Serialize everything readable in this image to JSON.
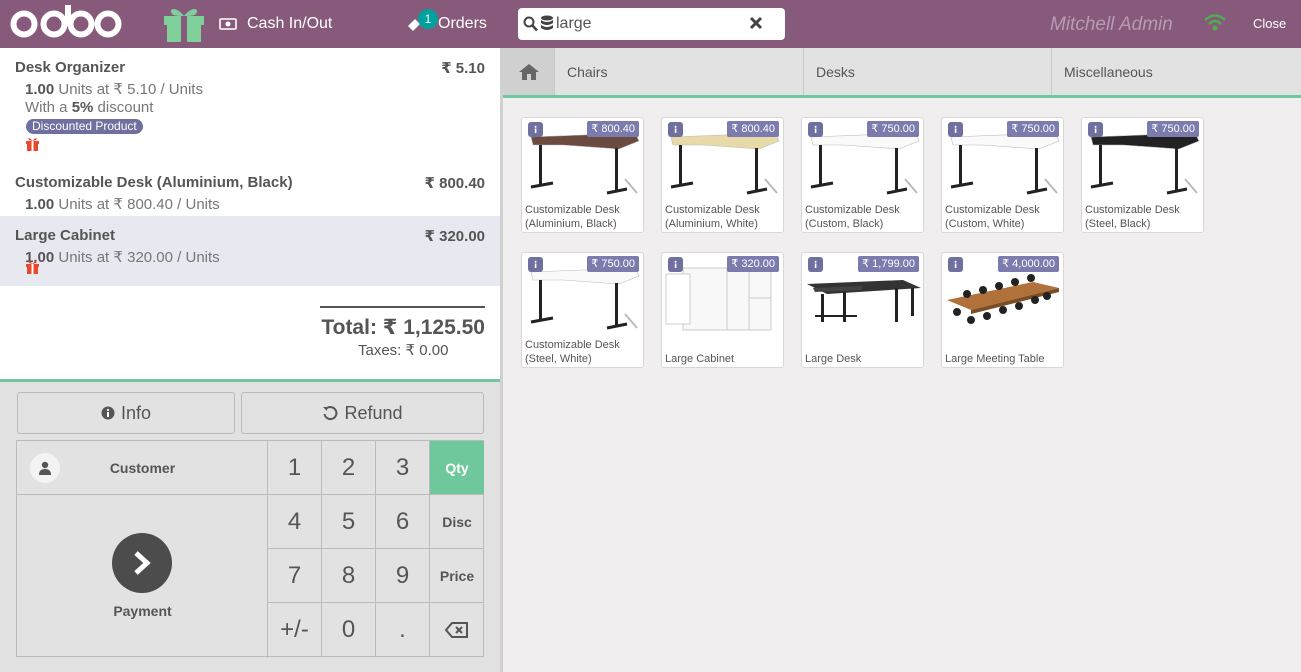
{
  "header": {
    "logo_text": "odoo",
    "cash_label": "Cash In/Out",
    "orders_label": "Orders",
    "orders_badge": "1",
    "search_value": "large",
    "user_name": "Mitchell Admin",
    "close_label": "Close"
  },
  "order": {
    "lines": [
      {
        "name": "Desk Organizer",
        "price": "₹ 5.10",
        "qty": "1.00",
        "unit_text": "Units at ₹ 5.10 / Units",
        "disc_prefix": "With a",
        "disc_value": "5%",
        "disc_suffix": "discount",
        "badge": "Discounted Product"
      },
      {
        "name": "Customizable Desk (Aluminium, Black)",
        "price": "₹ 800.40",
        "qty": "1.00",
        "unit_text": "Units at ₹ 800.40 / Units"
      },
      {
        "name": "Large Cabinet",
        "price": "₹ 320.00",
        "qty": "1.00",
        "unit_text": "Units at ₹ 320.00 / Units"
      }
    ],
    "total_label": "Total:",
    "total_value": "₹ 1,125.50",
    "taxes_label": "Taxes:",
    "taxes_value": "₹ 0.00"
  },
  "controls": {
    "info_label": "Info",
    "refund_label": "Refund",
    "customer_label": "Customer",
    "payment_label": "Payment"
  },
  "numpad": {
    "keys": [
      "1",
      "2",
      "3",
      "4",
      "5",
      "6",
      "7",
      "8",
      "9",
      "+/-",
      "0",
      "."
    ],
    "modes": [
      "Qty",
      "Disc",
      "Price"
    ],
    "active_mode": "Qty"
  },
  "categories": [
    "Chairs",
    "Desks",
    "Miscellaneous"
  ],
  "products": [
    {
      "name": "Customizable Desk (Aluminium, Black)",
      "price": "₹ 800.40",
      "image": "desk-brown-top"
    },
    {
      "name": "Customizable Desk (Aluminium, White)",
      "price": "₹ 800.40",
      "image": "desk-beige-top"
    },
    {
      "name": "Customizable Desk (Custom, Black)",
      "price": "₹ 750.00",
      "image": "desk-white-top"
    },
    {
      "name": "Customizable Desk (Custom, White)",
      "price": "₹ 750.00",
      "image": "desk-white-top"
    },
    {
      "name": "Customizable Desk (Steel, Black)",
      "price": "₹ 750.00",
      "image": "desk-black-top"
    },
    {
      "name": "Customizable Desk (Steel, White)",
      "price": "₹ 750.00",
      "image": "desk-white-top"
    },
    {
      "name": "Large Cabinet",
      "price": "₹ 320.00",
      "image": "white-cabinet"
    },
    {
      "name": "Large Desk",
      "price": "₹ 1,799.00",
      "image": "grey-large-desk"
    },
    {
      "name": "Large Meeting Table",
      "price": "₹ 4,000.00",
      "image": "wood-meeting-table"
    }
  ],
  "colors": {
    "header": "#875a7b",
    "accent": "#6ec89b",
    "badge": "#00a09d",
    "tag": "#7c7bad"
  }
}
